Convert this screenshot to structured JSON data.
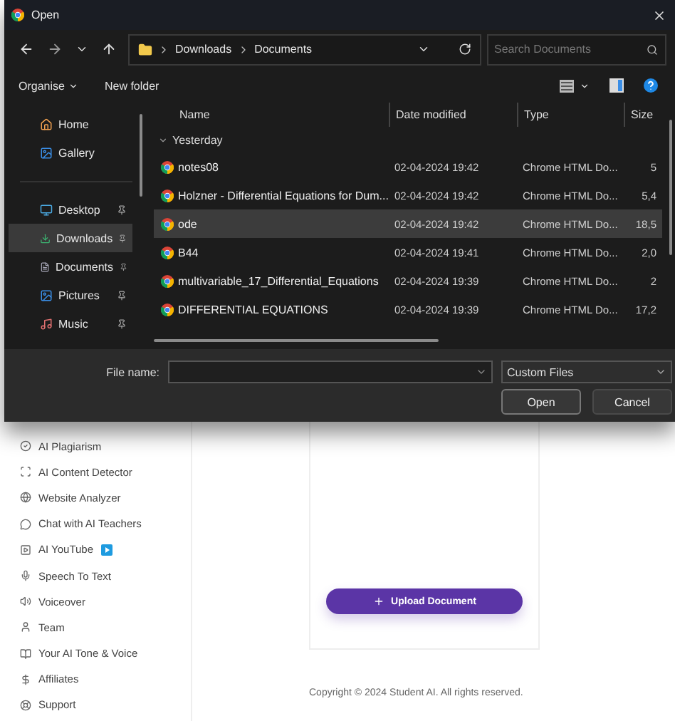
{
  "dialog": {
    "title": "Open",
    "breadcrumb": [
      "Downloads",
      "Documents"
    ],
    "search": {
      "placeholder": "Search Documents"
    },
    "toolbar": {
      "organise": "Organise",
      "new_folder": "New folder"
    },
    "nav_items": [
      {
        "label": "Home",
        "pinned": false,
        "selected": false
      },
      {
        "label": "Gallery",
        "pinned": false,
        "selected": false
      },
      {
        "label": "Desktop",
        "pinned": true,
        "selected": false
      },
      {
        "label": "Downloads",
        "pinned": true,
        "selected": true
      },
      {
        "label": "Documents",
        "pinned": true,
        "selected": false
      },
      {
        "label": "Pictures",
        "pinned": true,
        "selected": false
      },
      {
        "label": "Music",
        "pinned": true,
        "selected": false
      }
    ],
    "columns": [
      "Name",
      "Date modified",
      "Type",
      "Size"
    ],
    "groups": [
      {
        "label": "Yesterday",
        "expanded": true,
        "files": [
          {
            "name": "notes08",
            "date": "02-04-2024 19:42",
            "type": "Chrome HTML Do...",
            "size": "5",
            "selected": false
          },
          {
            "name": "Holzner - Differential Equations for Dum...",
            "date": "02-04-2024 19:42",
            "type": "Chrome HTML Do...",
            "size": "5,4",
            "selected": false
          },
          {
            "name": "ode",
            "date": "02-04-2024 19:42",
            "type": "Chrome HTML Do...",
            "size": "18,5",
            "selected": true
          },
          {
            "name": "B44",
            "date": "02-04-2024 19:41",
            "type": "Chrome HTML Do...",
            "size": "2,0",
            "selected": false
          },
          {
            "name": "multivariable_17_Differential_Equations",
            "date": "02-04-2024 19:39",
            "type": "Chrome HTML Do...",
            "size": "2",
            "selected": false
          },
          {
            "name": "DIFFERENTIAL EQUATIONS",
            "date": "02-04-2024 19:39",
            "type": "Chrome HTML Do...",
            "size": "17,2",
            "selected": false
          }
        ]
      }
    ],
    "file_name_label": "File name:",
    "file_type": "Custom Files",
    "buttons": [
      "Open",
      "Cancel"
    ]
  },
  "page": {
    "sidebar": [
      "AI Plagiarism",
      "AI Content Detector",
      "Website Analyzer",
      "Chat with AI Teachers",
      "AI YouTube",
      "Speech To Text",
      "Voiceover",
      "Team",
      "Your AI Tone & Voice",
      "Affiliates",
      "Support"
    ],
    "upload_button": "Upload Document",
    "copyright": "Copyright © 2024 Student AI. All rights reserved."
  }
}
